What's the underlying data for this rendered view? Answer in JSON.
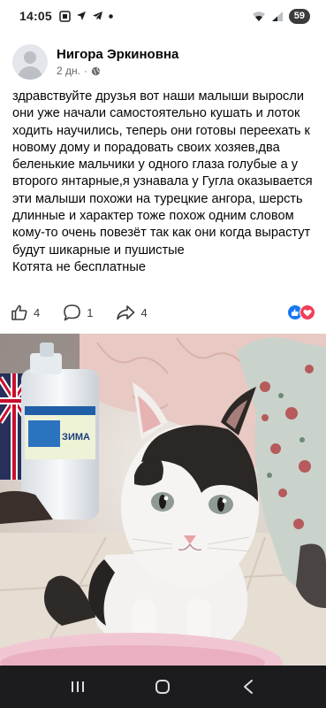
{
  "status_bar": {
    "time": "14:05",
    "battery": "59"
  },
  "post": {
    "author": "Нигора Эркиновна",
    "time_ago": "2 дн.",
    "separator": "·",
    "text_lines": [
      "здравствуйте друзья вот наши малыши выросли они уже начали самостоятельно кушать и лоток ходить научились, теперь они готовы переехать к новому дому и порадовать своих хозяев,два беленькие мальчики у одного глаза голубые а у второго янтарные,я узнавала у Гугла оказывается эти малыши  похожи на турецкие ангора, шерсть длинные и характер тоже похож одним словом кому-то очень повезёт так как они когда вырастут будут шикарные и пушистые",
      "Котята не бесплатные"
    ],
    "likes_count": "4",
    "comments_count": "1",
    "shares_count": "4"
  },
  "icons": {
    "status": [
      "gallery-icon",
      "navigation-icon",
      "telegram-icon",
      "dot-icon"
    ],
    "status_right": [
      "wifi-icon",
      "signal-icon",
      "battery-icon"
    ],
    "reactions": [
      "like-reaction-icon",
      "love-reaction-icon"
    ],
    "nav": [
      "recent-apps-icon",
      "home-icon",
      "back-icon"
    ]
  },
  "colors": {
    "like_blue": "#1877f2",
    "love_red": "#f33e58",
    "nav_bar": "#1c1c1e",
    "meta_gray": "#65676b"
  },
  "photo": {
    "bottle_label": "ЗИМА"
  }
}
